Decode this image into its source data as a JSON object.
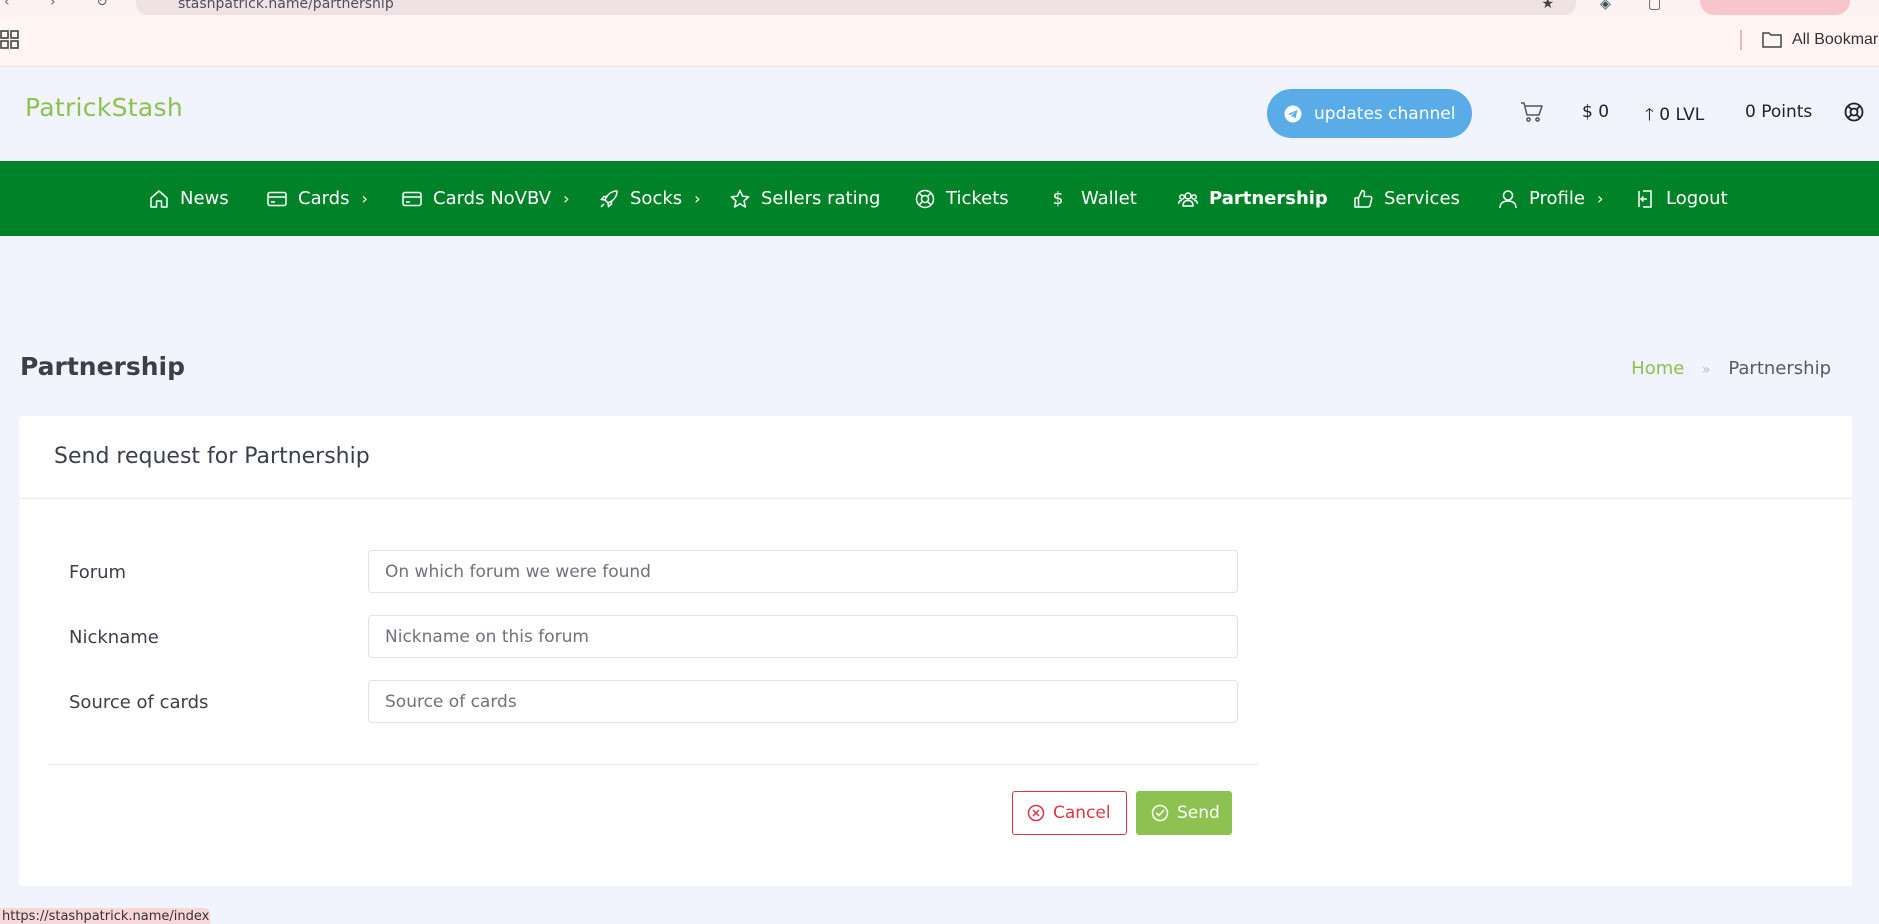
{
  "browser": {
    "url": "stashpatrick.name/partnership",
    "bookmarks_label": "All Bookmarks",
    "status_url": "https://stashpatrick.name/index"
  },
  "header": {
    "brand": "PatrickStash",
    "updates_label": "updates channel",
    "balance": "$  0",
    "level": "0 LVL",
    "points": "0 Points"
  },
  "nav": {
    "items": [
      {
        "label": "News"
      },
      {
        "label": "Cards"
      },
      {
        "label": "Cards NoVBV"
      },
      {
        "label": "Socks"
      },
      {
        "label": "Sellers rating"
      },
      {
        "label": "Tickets"
      },
      {
        "label": "Wallet"
      },
      {
        "label": "Partnership"
      },
      {
        "label": "Services"
      },
      {
        "label": "Profile"
      },
      {
        "label": "Logout"
      }
    ],
    "chevron": "›",
    "wallet_symbol": "$"
  },
  "page": {
    "title": "Partnership",
    "breadcrumb": {
      "home": "Home",
      "separator": "»",
      "current": "Partnership"
    }
  },
  "form": {
    "title": "Send request for Partnership",
    "fields": [
      {
        "label": "Forum",
        "placeholder": "On which forum we were found",
        "value": ""
      },
      {
        "label": "Nickname",
        "placeholder": "Nickname on this forum",
        "value": ""
      },
      {
        "label": "Source of cards",
        "placeholder": "Source of cards",
        "value": ""
      }
    ],
    "cancel_label": "Cancel",
    "send_label": "Send"
  },
  "colors": {
    "nav_bg": "#008229",
    "brand": "#8dc152",
    "updates_btn": "#5aace9",
    "cancel": "#dc3545",
    "send": "#8dc152",
    "page_bg": "#f1f3fd"
  }
}
